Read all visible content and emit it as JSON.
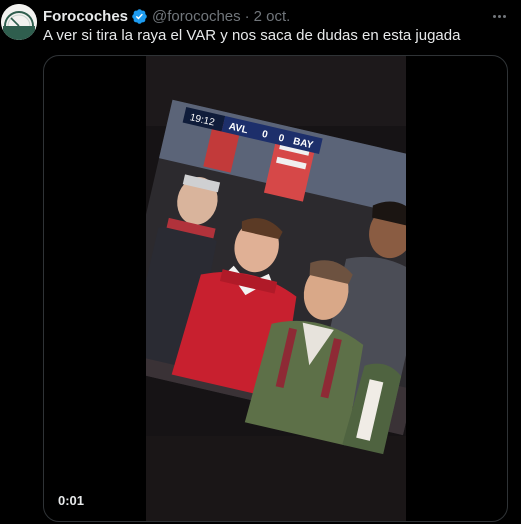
{
  "author": {
    "name": "Forocoches",
    "handle": "@forocoches",
    "separator": "·",
    "date": "2 oct.",
    "avatar_icon": "forocoches-gauge-logo",
    "verified_icon": "verified-badge-icon"
  },
  "tweet": {
    "text": "A ver si tira la raya el VAR y nos saca de dudas en esta jugada"
  },
  "video": {
    "elapsed": "0:01",
    "scoreboard": {
      "clock": "19:12",
      "home": "AVL",
      "home_score": "0",
      "away_score": "0",
      "away": "BAY"
    }
  },
  "colors": {
    "background": "#000000",
    "text": "#e7e9ea",
    "secondary": "#71767b",
    "verified": "#1d9bf0",
    "border": "#2f3336"
  }
}
